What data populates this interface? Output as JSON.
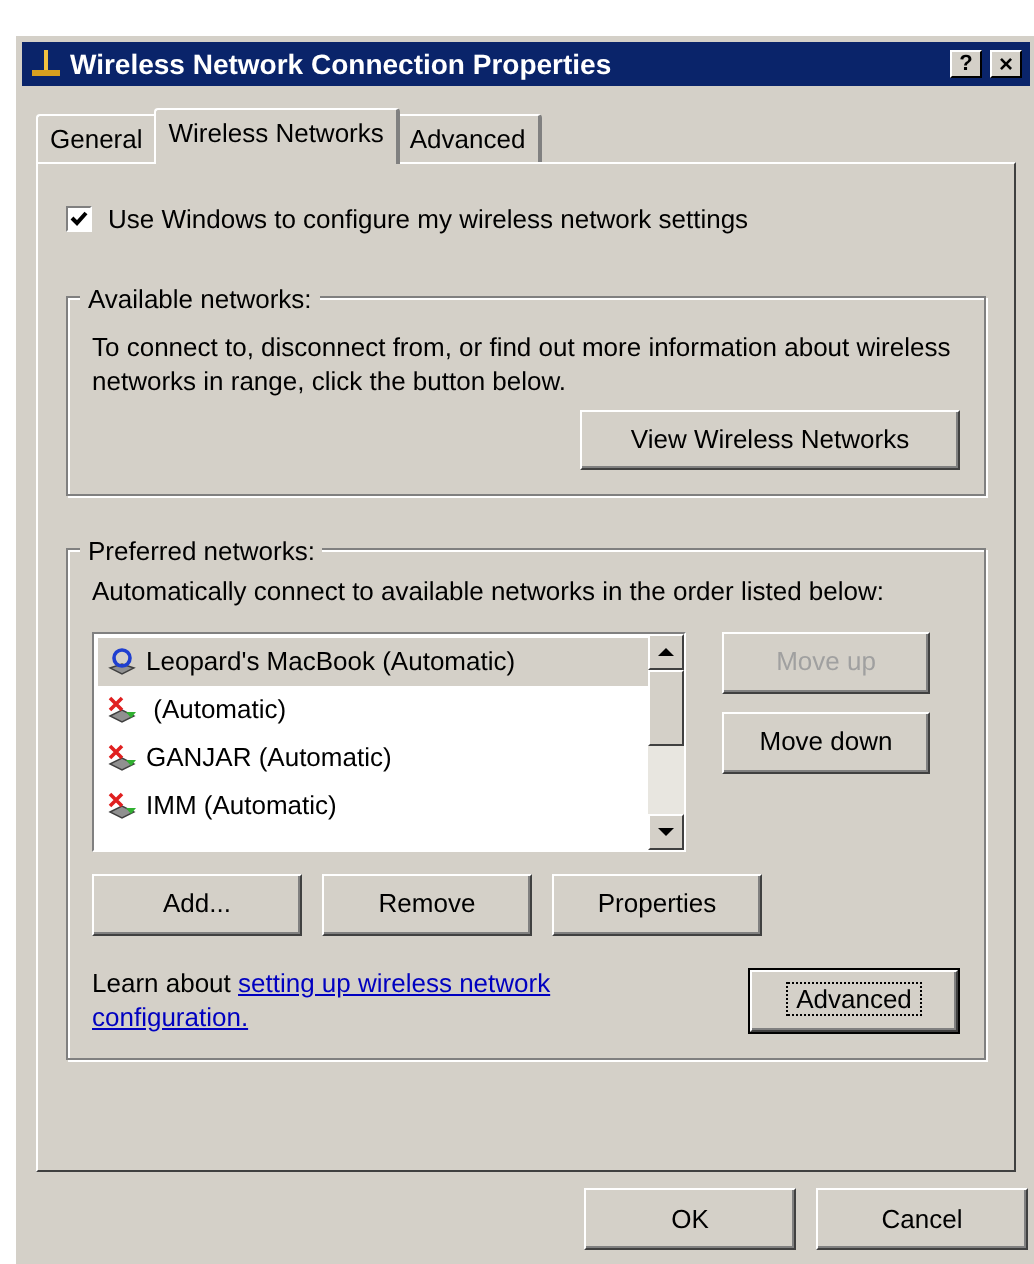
{
  "window": {
    "title": "Wireless Network Connection Properties",
    "help_button": "?",
    "close_button": "×"
  },
  "tabs": [
    {
      "label": "General",
      "selected": false
    },
    {
      "label": "Wireless Networks",
      "selected": true
    },
    {
      "label": "Advanced",
      "selected": false
    }
  ],
  "use_windows_checkbox": {
    "label": "Use Windows to configure my wireless network settings",
    "checked": true
  },
  "available_networks": {
    "title": "Available networks:",
    "description": "To connect to, disconnect from, or find out more information about wireless networks in range, click the button below.",
    "button": "View Wireless Networks"
  },
  "preferred_networks": {
    "title": "Preferred networks:",
    "description": "Automatically connect to available networks in the order listed below:",
    "networks": [
      {
        "name": "Leopard's MacBook (Automatic)",
        "kind": "connected",
        "selected": true
      },
      {
        "name": " (Automatic)",
        "kind": "unavailable",
        "selected": false
      },
      {
        "name": "GANJAR (Automatic)",
        "kind": "unavailable",
        "selected": false
      },
      {
        "name": "IMM (Automatic)",
        "kind": "unavailable",
        "selected": false
      }
    ],
    "side_buttons": [
      {
        "label": "Move up",
        "disabled": true
      },
      {
        "label": "Move down",
        "disabled": false
      }
    ],
    "buttons": [
      "Add...",
      "Remove",
      "Properties"
    ]
  },
  "learn": {
    "prefix": "Learn about ",
    "link": "setting up wireless network configuration."
  },
  "advanced_button": {
    "label": "Advanced",
    "default": true
  },
  "dialog_buttons": [
    "OK",
    "Cancel"
  ]
}
